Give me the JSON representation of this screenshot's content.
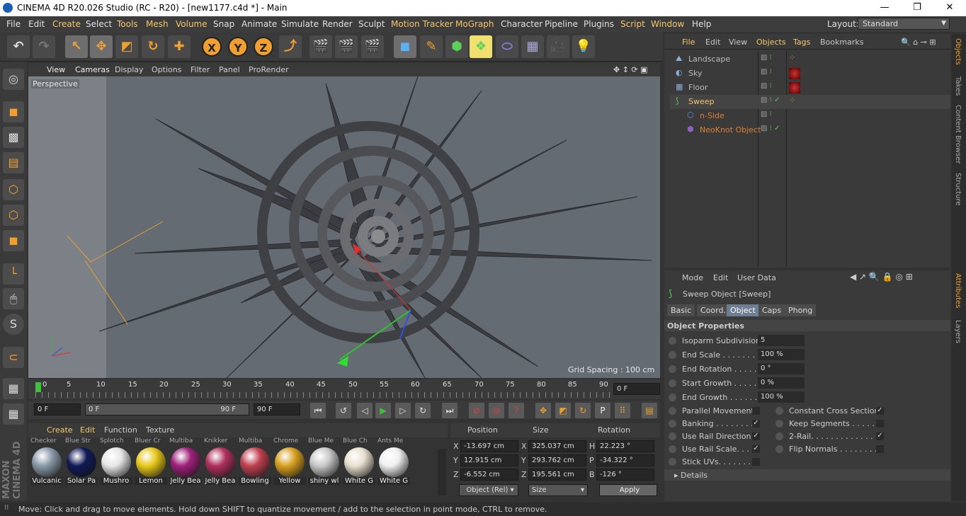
{
  "title_bar": {
    "text": "CINEMA 4D R20.026 Studio (RC - R20) - [new1177.c4d *] - Main",
    "min": "—",
    "max": "❐",
    "close": "✕"
  },
  "menu": [
    "File",
    "Edit",
    "Create",
    "Select",
    "Tools",
    "Mesh",
    "Volume",
    "Snap",
    "Animate",
    "Simulate",
    "Render",
    "Sculpt",
    "Motion Tracker",
    "MoGraph",
    "Character",
    "Pipeline",
    "Plugins",
    "Script",
    "Window",
    "Help"
  ],
  "layout": {
    "label": "Layout:",
    "value": "Standard"
  },
  "viewport": {
    "menu": [
      "View",
      "Cameras",
      "Display",
      "Options",
      "Filter",
      "Panel",
      "ProRender"
    ],
    "label": "Perspective",
    "grid_spacing": "Grid Spacing : 100 cm"
  },
  "timeline": {
    "ticks": [
      "0",
      "5",
      "10",
      "15",
      "20",
      "25",
      "30",
      "35",
      "40",
      "45",
      "50",
      "55",
      "60",
      "65",
      "70",
      "75",
      "80",
      "85",
      "90"
    ],
    "current": "0 F"
  },
  "playback": {
    "start": "0 F",
    "range_start": "0 F",
    "range_end": "90 F",
    "end": "90 F"
  },
  "materials": {
    "menu": [
      "Create",
      "Edit",
      "Function",
      "Texture"
    ],
    "items": [
      {
        "label": "Vulcanic",
        "color": "#8a9aa8",
        "top": "Checker"
      },
      {
        "label": "Solar Pa",
        "color": "#101a55",
        "top": "Blue Str"
      },
      {
        "label": "Mushro",
        "color": "#e6e6e6",
        "top": "Splotch"
      },
      {
        "label": "Lemon",
        "color": "#e8c81a",
        "top": "Bluer Cr"
      },
      {
        "label": "Jelly Bea",
        "color": "#a0207a",
        "top": "Multiba"
      },
      {
        "label": "Jelly Bea",
        "color": "#b03060",
        "top": "Knikker"
      },
      {
        "label": "Bowling",
        "color": "#c04050",
        "top": "Multiba"
      },
      {
        "label": "Yellow",
        "color": "#d8a020",
        "top": "Chrome"
      },
      {
        "label": "shiny wl",
        "color": "#c8c8c8",
        "top": "Blue Me"
      },
      {
        "label": "White G",
        "color": "#e8e0d0",
        "top": "Blue Ch"
      },
      {
        "label": "White G",
        "color": "#f0f0f0",
        "top": "Ants Me"
      }
    ]
  },
  "coords": {
    "headers": [
      "Position",
      "Size",
      "Rotation"
    ],
    "rows": [
      {
        "axis": "X",
        "pos": "-13.697 cm",
        "size_axis": "X",
        "size": "325.037 cm",
        "rot_axis": "H",
        "rot": "22.223 °"
      },
      {
        "axis": "Y",
        "pos": "12.915 cm",
        "size_axis": "Y",
        "size": "293.762 cm",
        "rot_axis": "P",
        "rot": "-34.322 °"
      },
      {
        "axis": "Z",
        "pos": "-6.552 cm",
        "size_axis": "Z",
        "size": "195.561 cm",
        "rot_axis": "B",
        "rot": "-126 °"
      }
    ],
    "mode": "Object (Rel)",
    "size_mode": "Size",
    "apply": "Apply"
  },
  "status": "Move: Click and drag to move elements. Hold down SHIFT to quantize movement / add to the selection in point mode, CTRL to remove.",
  "objects": {
    "menu": [
      "File",
      "Edit",
      "View",
      "Objects",
      "Tags",
      "Bookmarks"
    ],
    "items": [
      {
        "name": "Landscape",
        "indent": 0,
        "style": ""
      },
      {
        "name": "Sky",
        "indent": 0,
        "style": ""
      },
      {
        "name": "Floor",
        "indent": 0,
        "style": ""
      },
      {
        "name": "Sweep",
        "indent": 0,
        "style": "act"
      },
      {
        "name": "n-Side",
        "indent": 1,
        "style": "orange"
      },
      {
        "name": "NeoKnot Object",
        "indent": 1,
        "style": "orange"
      }
    ]
  },
  "attributes": {
    "menu": [
      "Mode",
      "Edit",
      "User Data"
    ],
    "object_title": "Sweep Object [Sweep]",
    "tabs": [
      "Basic",
      "Coord.",
      "Object",
      "Caps",
      "Phong"
    ],
    "section": "Object Properties",
    "props": [
      {
        "label": "Isoparm Subdivision",
        "value": "5"
      },
      {
        "label": "End Scale . . . . . . . . . .",
        "value": "100 %"
      },
      {
        "label": "End Rotation . . . . . .",
        "value": "0 °"
      },
      {
        "label": "Start Growth . . . . . .",
        "value": "0 %"
      },
      {
        "label": "End Growth . . . . . . .",
        "value": "100 %"
      }
    ],
    "checks_left": [
      {
        "label": "Parallel Movement",
        "on": ""
      },
      {
        "label": "Banking . . . . . . . . .",
        "on": "✓"
      },
      {
        "label": "Use Rail Direction",
        "on": "✓"
      },
      {
        "label": "Use Rail Scale. . . .",
        "on": "✓"
      },
      {
        "label": "Stick UVs. . . . . . . .",
        "on": ""
      }
    ],
    "checks_right": [
      {
        "label": "Constant Cross Section",
        "on": "✓"
      },
      {
        "label": "Keep Segments . . . . . .",
        "on": ""
      },
      {
        "label": "2-Rail. . . . . . . . . . . . .",
        "on": "✓"
      },
      {
        "label": "Flip Normals . . . . . . . . .",
        "on": ""
      }
    ],
    "details": "Details"
  },
  "side_tabs": [
    "Objects",
    "Takes",
    "Content Browser",
    "Structure",
    "Attributes",
    "Layers"
  ]
}
